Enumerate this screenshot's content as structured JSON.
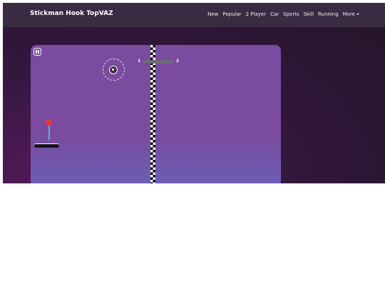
{
  "site": {
    "brand": "Stickman Hook TopVAZ",
    "nav": [
      "New",
      "Popular",
      "2 Player",
      "Car",
      "Sports",
      "Skill",
      "Running",
      "More"
    ]
  },
  "game": {
    "progress": {
      "start_label": "1",
      "end_label": "2",
      "value": 0
    },
    "icons": [
      "pause-icon",
      "hook-anchor-icon",
      "stickman-icon"
    ],
    "colors": {
      "background_top": "#7a4b9e",
      "background_bottom": "#6a5fb7",
      "player_head": "#e23a3a",
      "player_body": "#55b8d6"
    }
  }
}
